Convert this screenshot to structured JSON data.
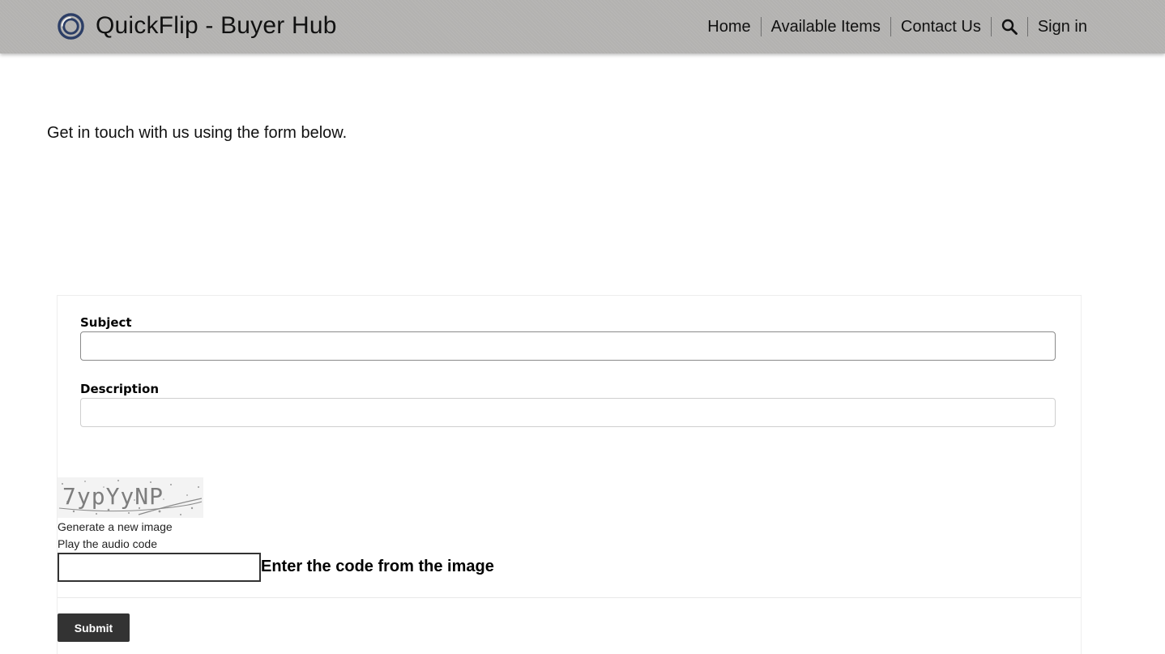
{
  "header": {
    "title": "QuickFlip - Buyer Hub",
    "logo_icon": "ring-logo-icon",
    "nav": [
      {
        "label": "Home"
      },
      {
        "label": "Available Items"
      },
      {
        "label": "Contact Us"
      },
      {
        "icon": "search-icon"
      },
      {
        "label": "Sign in"
      }
    ]
  },
  "intro_text": "Get in touch with us using the form below.",
  "form": {
    "subject_label": "Subject",
    "subject_value": "",
    "description_label": "Description",
    "description_value": "",
    "captcha_text": "7ypYyNP",
    "new_image_link": "Generate a new image",
    "audio_link": "Play the audio code",
    "code_value": "",
    "code_label": "Enter the code from the image",
    "submit_label": "Submit"
  },
  "colors": {
    "header_bg": "#b3b2b0",
    "submit_bg": "#333333",
    "logo_blue": "#2c3e66"
  }
}
